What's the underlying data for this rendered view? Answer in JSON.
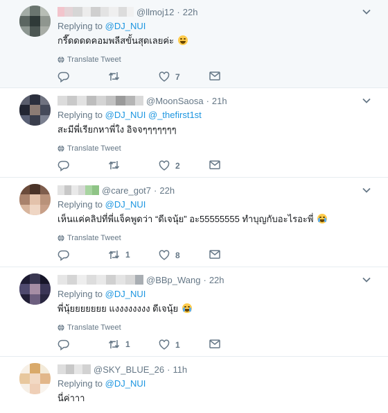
{
  "tweets": [
    {
      "handle": "@llmoj12",
      "time": "22h",
      "replying_label": "Replying to",
      "mentions": [
        "@DJ_NUI"
      ],
      "text": "กรี๊ดดดดคอมพลีสขั้นสุดเลยค่ะ",
      "emoji": "laughing-crying",
      "translate_label": "Translate Tweet",
      "retweets": "",
      "likes": "7",
      "highlighted": true,
      "colors": {
        "name_blocks": [
          "#f4c7cf",
          "#e9d9dc",
          "#d9d9d9",
          "#ececec",
          "#d0d0d0",
          "#e1e1e1",
          "#eeeeee"
        ]
      }
    },
    {
      "handle": "@MoonSaosa",
      "time": "21h",
      "replying_label": "Replying to",
      "mentions": [
        "@DJ_NUI",
        "@_thefirst1st"
      ],
      "text": "สะมีพี่เรียกหาพี่ใง อิจจๆๆๆๆๆๆๆ",
      "emoji": "",
      "translate_label": "Translate Tweet",
      "retweets": "",
      "likes": "2",
      "highlighted": false
    },
    {
      "handle": "@care_got7",
      "time": "22h",
      "replying_label": "Replying to",
      "mentions": [
        "@DJ_NUI"
      ],
      "text": "เห็นแค่คลิปที่พี่แจ็คพูดว่า “ดีเจนุ้ย” อะ55555555 ทำบุญกับอะไรอะพี่",
      "emoji": "crying",
      "translate_label": "Translate Tweet",
      "retweets": "1",
      "likes": "8",
      "highlighted": false
    },
    {
      "handle": "@BBp_Wang",
      "time": "22h",
      "replying_label": "Replying to",
      "mentions": [
        "@DJ_NUI"
      ],
      "text": "พี่นุ้ยยยยยยย แงงงงงงงง ดีเจนุ้ย",
      "emoji": "crying",
      "translate_label": "Translate Tweet",
      "retweets": "1",
      "likes": "1",
      "highlighted": false
    },
    {
      "handle": "@SKY_BLUE_26",
      "time": "11h",
      "replying_label": "Replying to",
      "mentions": [
        "@DJ_NUI"
      ],
      "text": "นี่ค่าาา",
      "emoji": "",
      "translate_label": "",
      "retweets": "",
      "likes": "",
      "highlighted": false
    }
  ],
  "separator": "·",
  "accent_color": "#1b95e0",
  "muted_color": "#657786",
  "icons": [
    "reply-icon",
    "retweet-icon",
    "like-icon",
    "message-icon",
    "globe-icon",
    "chevron-down-icon"
  ]
}
